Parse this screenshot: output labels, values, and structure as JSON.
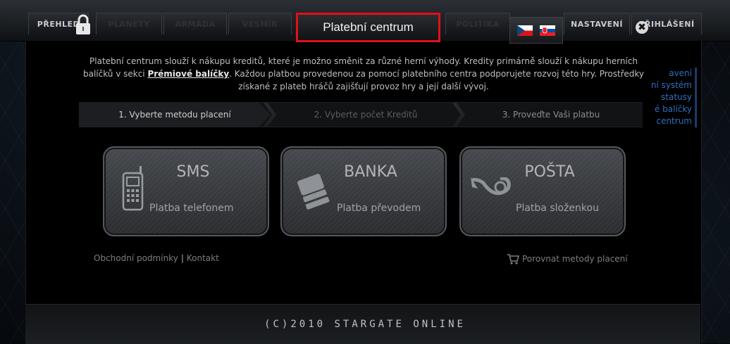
{
  "nav": {
    "tabs": [
      {
        "label": "PŘEHLED"
      },
      {
        "label": "PLANETY"
      },
      {
        "label": "ARMÁDA"
      },
      {
        "label": "VESMÍR"
      },
      {
        "label": "POLITIKA"
      },
      {
        "label": "NASTAVENÍ"
      },
      {
        "label": "PŘIHLÁŠENÍ"
      }
    ]
  },
  "dialog": {
    "title": "Platební centrum",
    "intro_1": "Platební centrum slouží k nákupu kreditů, které je možno směnit za různé herní výhody. Kredity primárně slouží k nákupu herních balíčků v sekci ",
    "intro_link": "Prémiové balíčky",
    "intro_2": ". Každou platbou provedenou za pomocí platebního centra podporujete rozvoj této hry. Prostředky získané z plateb hráčů zajišťují provoz hry a její další vývoj.",
    "side_list": [
      "avení",
      "ní systém",
      "statusy",
      "é balíčky",
      "centrum"
    ],
    "steps": [
      {
        "label": "1. Vyberte metodu placení"
      },
      {
        "label": "2. Vyberte počet Kreditů"
      },
      {
        "label": "3. Proveďte Vaši platbu"
      }
    ],
    "methods": [
      {
        "name": "SMS",
        "desc": "Platba telefonem",
        "icon": "phone-icon"
      },
      {
        "name": "BANKA",
        "desc": "Platba převodem",
        "icon": "cards-icon"
      },
      {
        "name": "POŠTA",
        "desc": "Platba složenkou",
        "icon": "post-horn-icon"
      }
    ],
    "footer": {
      "terms": "Obchodní podmínky",
      "separator": "|",
      "contact": "Kontakt",
      "compare": "Porovnat metody placení"
    }
  },
  "copyright": "(C)2010 STARGATE ONLINE",
  "colors": {
    "title_border": "#e0101a",
    "link": "#2f6fc0"
  }
}
